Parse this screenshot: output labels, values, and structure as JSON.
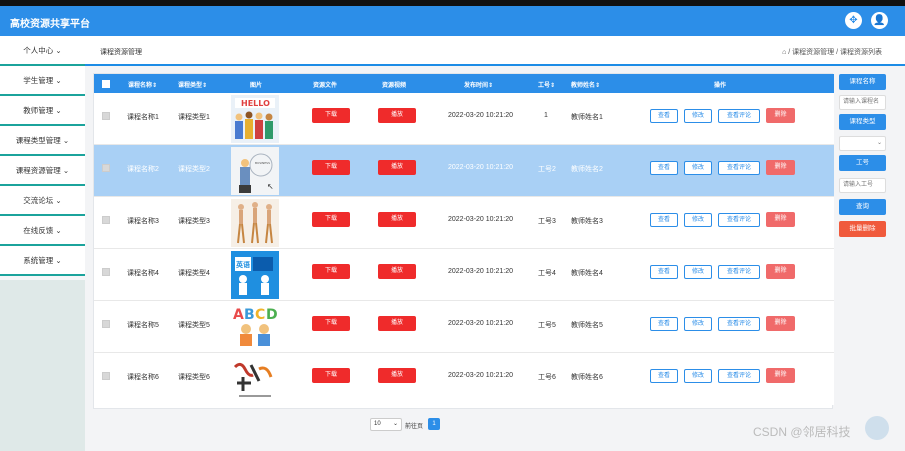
{
  "app": {
    "title": "高校资源共享平台"
  },
  "sidebar": {
    "items": [
      {
        "label": "个人中心"
      },
      {
        "label": "学生管理"
      },
      {
        "label": "教师管理"
      },
      {
        "label": "课程类型管理"
      },
      {
        "label": "课程资源管理"
      },
      {
        "label": "交流论坛"
      },
      {
        "label": "在线反馈"
      },
      {
        "label": "系统管理"
      }
    ]
  },
  "breadcrumb": {
    "page": "课程资源管理",
    "path": "⌂ / 课程资源管理 / 课程资源列表"
  },
  "table": {
    "headers": [
      "课程名称⇕",
      "课程类型⇕",
      "图片",
      "资源文件",
      "资源视频",
      "发布时间⇕",
      "工号⇕",
      "教师姓名⇕",
      "操作"
    ],
    "buttons": {
      "download": "下载",
      "play": "播放",
      "view": "查看",
      "edit": "修改",
      "comments": "查看评论",
      "delete": "删除"
    },
    "rows": [
      {
        "name": "课程名称1",
        "type": "课程类型1",
        "time": "2022-03-20 10:21:20",
        "no": "1",
        "teacher": "教师姓名1",
        "selected": false,
        "image": "hello-people"
      },
      {
        "name": "课程名称2",
        "type": "课程类型2",
        "time": "2022-03-20 10:21:20",
        "no": "工号2",
        "teacher": "教师姓名2",
        "selected": true,
        "image": "business-woman"
      },
      {
        "name": "课程名称3",
        "type": "课程类型3",
        "time": "2022-03-20 10:21:20",
        "no": "工号3",
        "teacher": "教师姓名3",
        "selected": false,
        "image": "dancers"
      },
      {
        "name": "课程名称4",
        "type": "课程类型4",
        "time": "2022-03-20 10:21:20",
        "no": "工号4",
        "teacher": "教师姓名4",
        "selected": false,
        "image": "english-blue"
      },
      {
        "name": "课程名称5",
        "type": "课程类型5",
        "time": "2022-03-20 10:21:20",
        "no": "工号5",
        "teacher": "教师姓名5",
        "selected": false,
        "image": "abcd-kids"
      },
      {
        "name": "课程名称6",
        "type": "课程类型6",
        "time": "2022-03-20 10:21:20",
        "no": "工号6",
        "teacher": "教师姓名6",
        "selected": false,
        "image": "calligraphy"
      }
    ]
  },
  "search": {
    "course_name_label": "课程名称",
    "course_name_placeholder": "请输入课程名",
    "course_type_label": "课程类型",
    "teacher_no_label": "工号",
    "teacher_no_placeholder": "请输入工号",
    "query_label": "查询",
    "batch_delete_label": "批量删除"
  },
  "pagination": {
    "page_size": "10",
    "goto_label": "前往页",
    "current_page": "1"
  },
  "watermark": "CSDN @邻居科技",
  "colors": {
    "primary": "#2c8ee8",
    "danger": "#ef2b2b",
    "selected_row": "#a9d0f5",
    "sidebar_accent": "#1ba39c"
  }
}
